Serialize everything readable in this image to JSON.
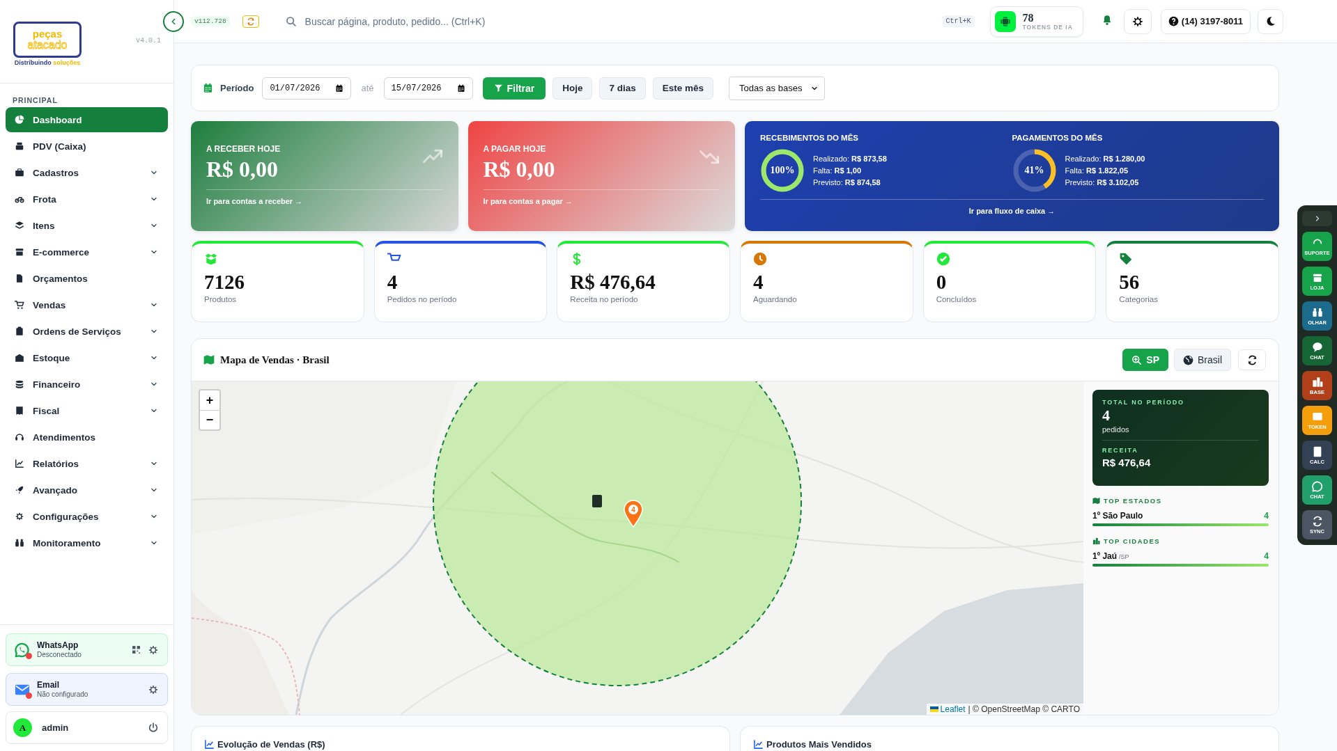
{
  "sidebar": {
    "logo": {
      "line1": "peças",
      "line2": "atacado",
      "tagline_1": "Distribuindo",
      "tagline_2": "soluções"
    },
    "version": "v4.0.1",
    "section": "PRINCIPAL",
    "items": [
      {
        "label": "Dashboard",
        "selected": true,
        "expandable": false
      },
      {
        "label": "PDV (Caixa)",
        "selected": false,
        "expandable": false
      },
      {
        "label": "Cadastros",
        "selected": false,
        "expandable": true
      },
      {
        "label": "Frota",
        "selected": false,
        "expandable": true
      },
      {
        "label": "Itens",
        "selected": false,
        "expandable": true
      },
      {
        "label": "E-commerce",
        "selected": false,
        "expandable": true
      },
      {
        "label": "Orçamentos",
        "selected": false,
        "expandable": false
      },
      {
        "label": "Vendas",
        "selected": false,
        "expandable": true
      },
      {
        "label": "Ordens de Serviços",
        "selected": false,
        "expandable": true
      },
      {
        "label": "Estoque",
        "selected": false,
        "expandable": true
      },
      {
        "label": "Financeiro",
        "selected": false,
        "expandable": true
      },
      {
        "label": "Fiscal",
        "selected": false,
        "expandable": true
      },
      {
        "label": "Atendimentos",
        "selected": false,
        "expandable": false
      },
      {
        "label": "Relatórios",
        "selected": false,
        "expandable": true
      },
      {
        "label": "Avançado",
        "selected": false,
        "expandable": true
      },
      {
        "label": "Configurações",
        "selected": false,
        "expandable": true
      },
      {
        "label": "Monitoramento",
        "selected": false,
        "expandable": true
      }
    ],
    "integrations": [
      {
        "kind": "whatsapp",
        "title": "WhatsApp",
        "status": "Desconectado",
        "connected": false
      },
      {
        "kind": "email",
        "title": "Email",
        "status": "Não configurado",
        "connected": false
      }
    ],
    "user": {
      "initial": "A",
      "name": "admin"
    }
  },
  "header": {
    "build": "v112.728",
    "search": {
      "placeholder": "Buscar página, produto, pedido... (Ctrl+K)",
      "shortcut": "Ctrl+K"
    },
    "tokens": {
      "count": "78",
      "label": "TOKENS DE IA"
    },
    "phone": "(14) 3197-8011"
  },
  "filters": {
    "label": "Período",
    "from": "01/07/2026",
    "separator": "até",
    "to": "15/07/2026",
    "apply": "Filtrar",
    "presets": [
      {
        "label": "Hoje",
        "selected": false
      },
      {
        "label": "7 dias",
        "selected": false
      },
      {
        "label": "Este mês",
        "selected": false
      }
    ],
    "base_select": "Todas as bases"
  },
  "finance": {
    "receivable": {
      "title": "A RECEBER HOJE",
      "amount": "R$ 0,00",
      "link": "Ir para contas a receber →"
    },
    "payable": {
      "title": "A PAGAR HOJE",
      "amount": "R$ 0,00",
      "link": "Ir para contas a pagar →"
    },
    "month": {
      "groups": [
        {
          "title": "RECEBIMENTOS DO MÊS",
          "percent": "100%",
          "level": 1,
          "color": "#9be86a",
          "lines": [
            "Realizado: **R$ 873,58**",
            "Falta: **R$ 1,00**",
            "Previsto: **R$ 874,58**"
          ]
        },
        {
          "title": "PAGAMENTOS DO MÊS",
          "percent": "41%",
          "level": 0.41,
          "color": "#fbbf24",
          "lines": [
            "Realizado: **R$ 1.280,00**",
            "Falta: **R$ 1.822,05**",
            "Previsto: **R$ 3.102,05**"
          ]
        }
      ],
      "link": "Ir para fluxo de caixa →"
    }
  },
  "stats": [
    {
      "value": "7126",
      "label": "Produtos",
      "color": "#22e83a"
    },
    {
      "value": "4",
      "label": "Pedidos no período",
      "color": "#2454e6"
    },
    {
      "value": "R$ 476,64",
      "label": "Receita no período",
      "color": "#22e83a"
    },
    {
      "value": "4",
      "label": "Aguardando",
      "color": "#d97706"
    },
    {
      "value": "0",
      "label": "Concluídos",
      "color": "#22e83a"
    },
    {
      "value": "56",
      "label": "Categorias",
      "color": "#15803d"
    }
  ],
  "map": {
    "title": "Mapa de Vendas · Brasil",
    "buttons": [
      {
        "label": "SP",
        "selected": true
      },
      {
        "label": "Brasil",
        "selected": false
      }
    ],
    "zoom_in": "+",
    "zoom_out": "−",
    "marker": "4",
    "attribution_link": "Leaflet",
    "attribution": "| © OpenStreetMap © CARTO",
    "summary": {
      "total_label": "TOTAL NO PERÍODO",
      "total": "4",
      "total_unit": "pedidos",
      "revenue_label": "RECEITA",
      "revenue": "R$ 476,64"
    },
    "top_states": {
      "title": "TOP ESTADOS",
      "rows": [
        {
          "rank": "1º",
          "name": "São Paulo",
          "count": "4",
          "level": 1
        }
      ]
    },
    "top_cities": {
      "title": "TOP CIDADES",
      "rows": [
        {
          "rank": "1º",
          "name": "Jaú",
          "region": "/SP",
          "count": "4",
          "level": 1
        }
      ]
    }
  },
  "bottom_cards": [
    {
      "title": "Evolução de Vendas (R$)"
    },
    {
      "title": "Produtos Mais Vendidos"
    }
  ],
  "dock": {
    "items": [
      {
        "label": "SUPORTE",
        "color": "#16a34a"
      },
      {
        "label": "LOJA",
        "color": "#16a34a"
      },
      {
        "label": "OLHAR",
        "color": "#1c6a8c"
      },
      {
        "label": "CHAT",
        "color": "#166534"
      },
      {
        "label": "BASE",
        "color": "#b1401a"
      },
      {
        "label": "TOKEN",
        "color": "#f59e0b"
      },
      {
        "label": "CALC",
        "color": "#334155"
      },
      {
        "label": "CHAT",
        "color": "#22a06b"
      },
      {
        "label": "SYNC",
        "color": "#4b5563"
      }
    ]
  }
}
